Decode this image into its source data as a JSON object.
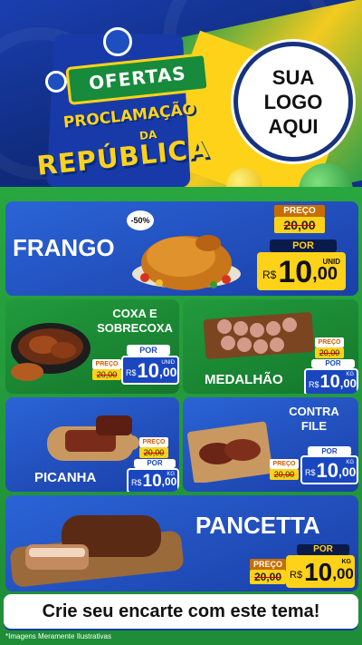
{
  "header": {
    "title_ofertas": "OFERTAS",
    "title_proclamacao": "PROCLAMAÇÃO",
    "title_da": "DA",
    "title_republica": "REPÚBLICA",
    "logo_line1": "SUA",
    "logo_line2": "LOGO",
    "logo_line3": "AQUI"
  },
  "products": {
    "frango": {
      "name": "FRANGO",
      "discount": "-50%",
      "preco_label": "PREÇO",
      "old_price": "20,00",
      "por_label": "POR",
      "currency": "R$",
      "price_int": "10",
      "price_dec": ",00",
      "unit": "UNID"
    },
    "coxa": {
      "name_line1": "COXA E",
      "name_line2": "SOBRECOXA",
      "preco_label": "PREÇO",
      "old_price": "20,00",
      "por_label": "POR",
      "currency": "R$",
      "price_int": "10",
      "price_dec": ",00",
      "unit": "UNID"
    },
    "medalhao": {
      "name": "MEDALHÃO",
      "preco_label": "PREÇO",
      "old_price": "20,00",
      "por_label": "POR",
      "currency": "R$",
      "price_int": "10",
      "price_dec": ",00",
      "unit": "KG"
    },
    "picanha": {
      "name": "PICANHA",
      "preco_label": "PREÇO",
      "old_price": "20,00",
      "por_label": "POR",
      "currency": "R$",
      "price_int": "10",
      "price_dec": ",00",
      "unit": "KG"
    },
    "contrafile": {
      "name_line1": "CONTRA",
      "name_line2": "FILE",
      "preco_label": "PREÇO",
      "old_price": "20,00",
      "por_label": "POR",
      "currency": "R$",
      "price_int": "10",
      "price_dec": ",00",
      "unit": "KG"
    },
    "pancetta": {
      "name": "PANCETTA",
      "preco_label": "PREÇO",
      "old_price": "20,00",
      "por_label": "POR",
      "currency": "R$",
      "price_int": "10",
      "price_dec": ",00",
      "unit": "KG"
    }
  },
  "cta": "Crie seu encarte com este tema!",
  "footnote": "*Imagens Meramente Ilustrativas",
  "colors": {
    "brand_blue": "#1a47c0",
    "brand_green": "#229a3c",
    "brand_yellow": "#ffd21a"
  }
}
